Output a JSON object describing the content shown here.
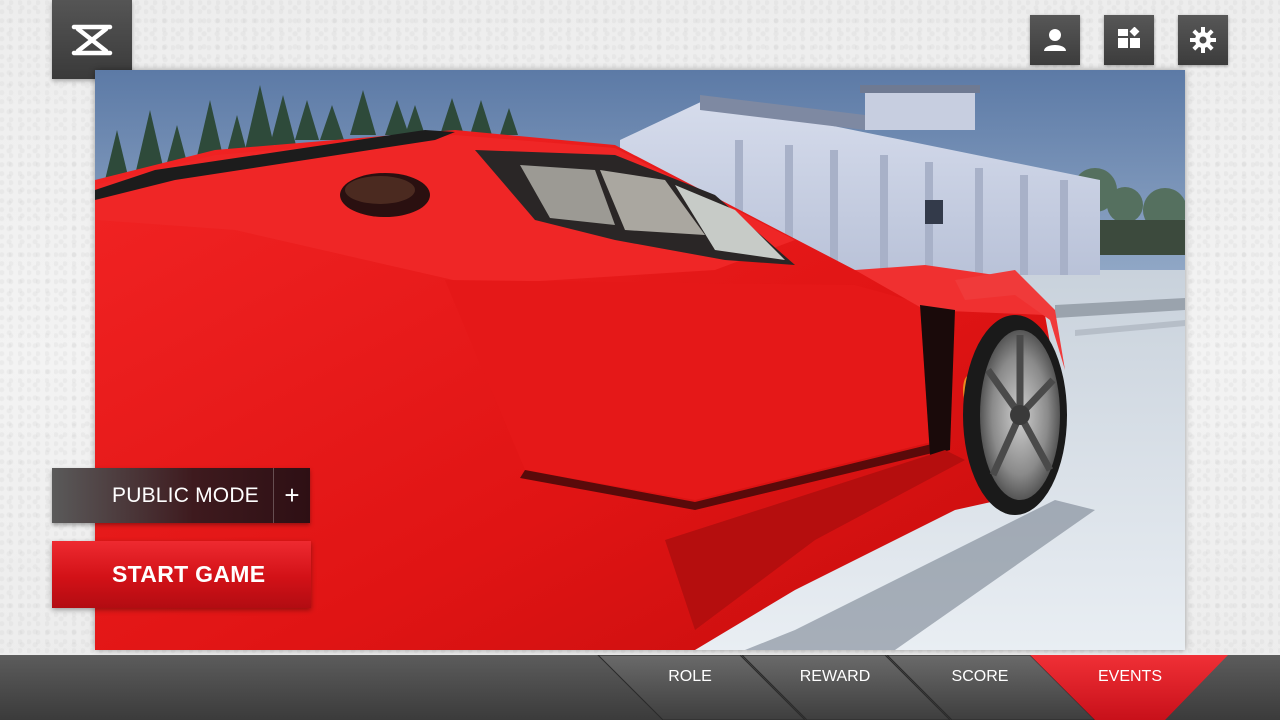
{
  "app": {
    "logo_icon": "capcut-logo-icon"
  },
  "top_icons": [
    {
      "name": "profile-icon"
    },
    {
      "name": "grid-icon"
    },
    {
      "name": "gear-icon"
    }
  ],
  "mode": {
    "label": "PUBLIC MODE",
    "add_label": "+"
  },
  "start": {
    "label": "START GAME"
  },
  "tabs": [
    {
      "label": "ROLE",
      "active": false
    },
    {
      "label": "REWARD",
      "active": false
    },
    {
      "label": "SCORE",
      "active": false
    },
    {
      "label": "EVENTS",
      "active": true
    }
  ],
  "colors": {
    "accent_red": "#d21117",
    "panel_dark": "#3c3c3c",
    "car_red": "#e11b1b"
  }
}
